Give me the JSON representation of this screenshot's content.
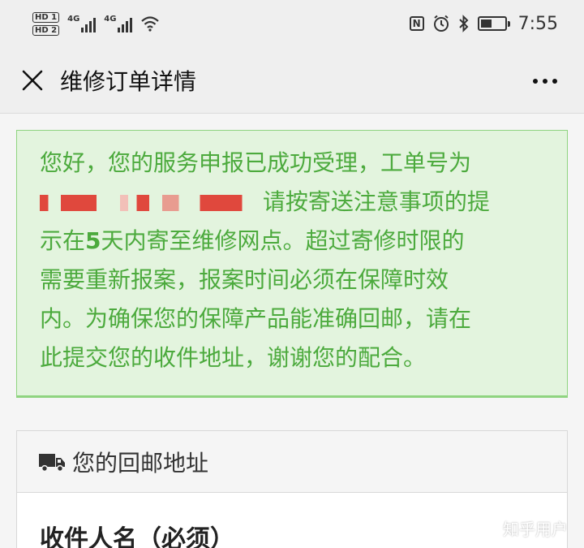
{
  "status_bar": {
    "hd1": "HD 1",
    "hd2": "HD 2",
    "net1": "4G",
    "net2": "4G",
    "time": "7:55",
    "nfc": "N"
  },
  "header": {
    "title": "维修订单详情"
  },
  "notice": {
    "line1": "您好，您的服务申报已成功受理，工单号为",
    "line2": "请按寄送注意事项的提",
    "line3a": "示在",
    "line3b": "5",
    "line3c": "天内寄至维修网点。超过寄修时限的",
    "line4": "需要重新报案，报案时间必须在保障时效",
    "line5": "内。为确保您的保障产品能准确回邮，请在",
    "line6": "此提交您的收件地址，谢谢您的配合。",
    "colors": {
      "text": "#4caa3d",
      "background": "#e3f4de",
      "border": "#8fd480"
    }
  },
  "address_card": {
    "heading": "您的回邮地址",
    "heading_icon": "truck-icon",
    "field_label": "收件人名（必须）"
  },
  "watermark": "知乎用户"
}
